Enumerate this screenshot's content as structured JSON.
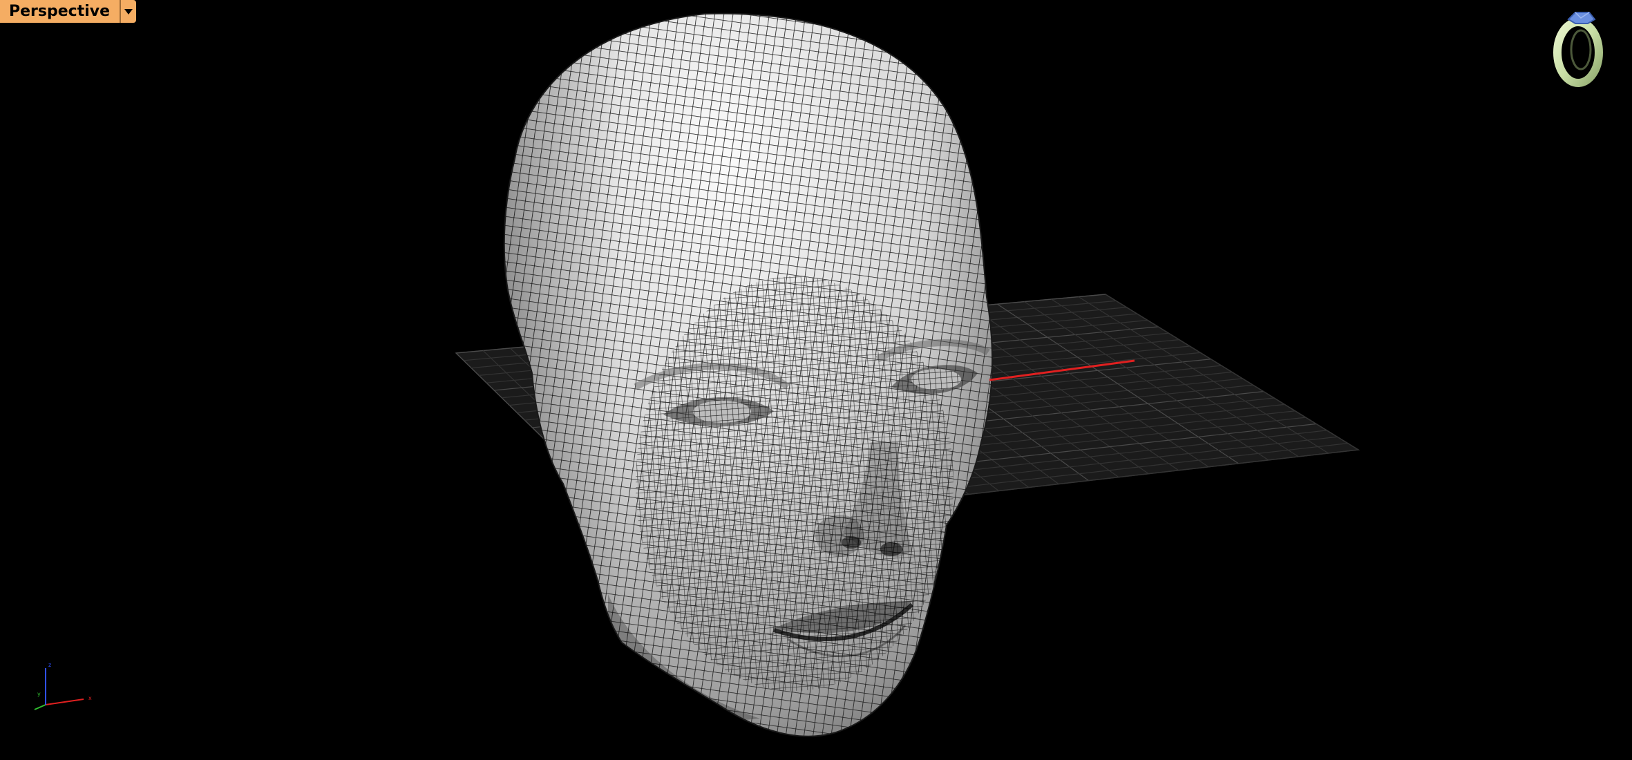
{
  "viewport": {
    "title": "Perspective",
    "menu_icon": "caret-down-icon",
    "background_color": "#000000",
    "tab_color": "#f5ad63"
  },
  "scene": {
    "object": "polygon-mesh-head",
    "mesh_fill_color": "#d8d8d8",
    "wire_color": "#111111",
    "grid_color": "#3a3a3a",
    "x_axis_color": "#e02020"
  },
  "axis_widget": {
    "icon": "world-axes-icon",
    "x_color": "#e02020",
    "y_color": "#30c030",
    "z_color": "#3050ff"
  },
  "render_preview": {
    "icon": "ring-render-icon",
    "body_color": "#c9dfa6",
    "gem_color": "#6a8fe0"
  }
}
